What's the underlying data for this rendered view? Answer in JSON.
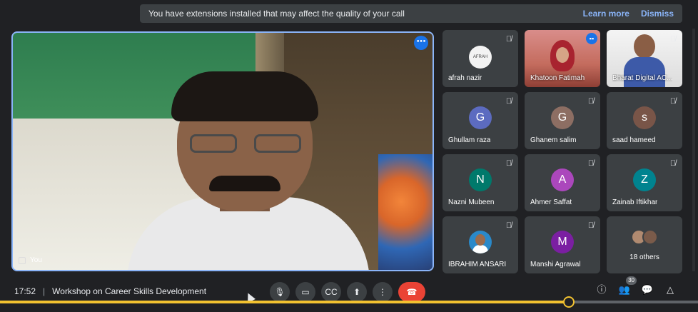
{
  "banner": {
    "message": "You have extensions installed that may affect the quality of your call",
    "learn_more": "Learn more",
    "dismiss": "Dismiss"
  },
  "main": {
    "speaker_label": "You",
    "more_icon": "more-options-icon"
  },
  "participants": [
    {
      "name": "afrah nazir",
      "type": "logo",
      "logo_text": "AFRAH"
    },
    {
      "name": "Khatoon Fatimah",
      "type": "video",
      "speaking": true
    },
    {
      "name": "Bharat Digital AC...",
      "type": "video"
    },
    {
      "name": "Ghullam raza",
      "type": "avatar",
      "initial": "G",
      "color": "#5c6bc0"
    },
    {
      "name": "Ghanem salim",
      "type": "avatar",
      "initial": "G",
      "color": "#8d6e63"
    },
    {
      "name": "saad hameed",
      "type": "avatar",
      "initial": "s",
      "color": "#795548"
    },
    {
      "name": "Nazni Mubeen",
      "type": "avatar",
      "initial": "N",
      "color": "#00796b"
    },
    {
      "name": "Ahmer Saffat",
      "type": "avatar",
      "initial": "A",
      "color": "#ab47bc"
    },
    {
      "name": "Zainab Iftikhar",
      "type": "avatar",
      "initial": "Z",
      "color": "#00838f"
    },
    {
      "name": "IBRAHIM ANSARI",
      "type": "photo"
    },
    {
      "name": "Manshi Agrawal",
      "type": "avatar",
      "initial": "M",
      "color": "#7b1fa2"
    },
    {
      "name": "18 others",
      "type": "others"
    }
  ],
  "bottom": {
    "time": "17:52",
    "separator": "|",
    "meeting_title": "Workshop on Career Skills Development",
    "people_count": "30"
  },
  "video_progress": 0.815,
  "colors": {
    "accent": "#8ab4f8",
    "end_call": "#ea4335",
    "progress": "#f2c230"
  }
}
